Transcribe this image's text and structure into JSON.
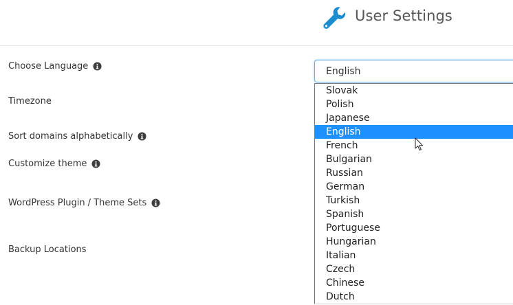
{
  "header": {
    "title": "User Settings",
    "icon": "wrench-icon",
    "icon_color": "#1a8ccf"
  },
  "labels": {
    "language": "Choose Language",
    "timezone": "Timezone",
    "sort_domains": "Sort domains alphabetically",
    "customize_theme": "Customize theme",
    "wp_sets": "WordPress Plugin / Theme Sets",
    "backup_locations": "Backup Locations"
  },
  "language_select": {
    "value": "English",
    "options": [
      "Slovak",
      "Polish",
      "Japanese",
      "English",
      "French",
      "Bulgarian",
      "Russian",
      "German",
      "Turkish",
      "Spanish",
      "Portuguese",
      "Hungarian",
      "Italian",
      "Czech",
      "Chinese",
      "Dutch"
    ],
    "highlighted": "English",
    "highlight_color": "#1e90ff"
  }
}
